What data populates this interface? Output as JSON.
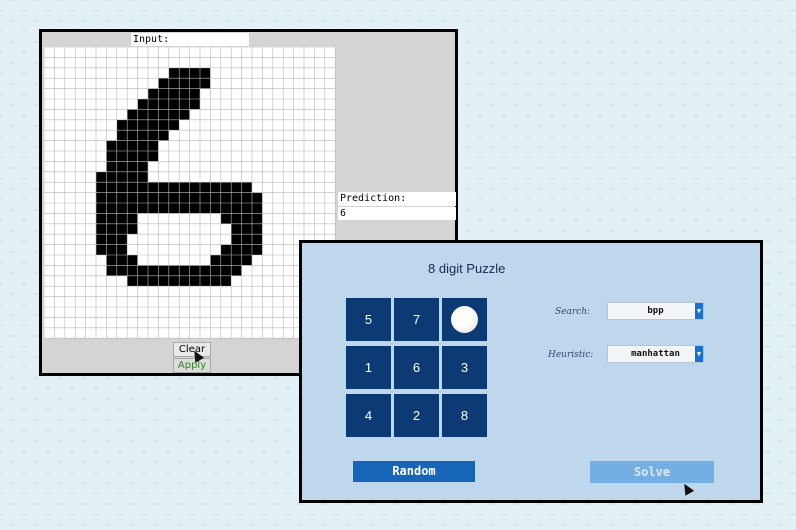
{
  "digit_app": {
    "input_label": "Input:",
    "prediction_label": "Prediction:",
    "prediction_value": "6",
    "clear_label": "Clear",
    "apply_label": "Apply",
    "grid": {
      "rows": 28,
      "cols": 28,
      "filled": [
        [
          2,
          12,
          15
        ],
        [
          3,
          11,
          15
        ],
        [
          4,
          10,
          14
        ],
        [
          5,
          9,
          14
        ],
        [
          6,
          8,
          13
        ],
        [
          7,
          7,
          12
        ],
        [
          8,
          7,
          11
        ],
        [
          9,
          6,
          10
        ],
        [
          10,
          6,
          10
        ],
        [
          11,
          6,
          9
        ],
        [
          12,
          5,
          9
        ],
        [
          13,
          5,
          19
        ],
        [
          14,
          5,
          20
        ],
        [
          15,
          5,
          20
        ],
        [
          16,
          5,
          8
        ],
        [
          16,
          17,
          20
        ],
        [
          17,
          5,
          8
        ],
        [
          17,
          18,
          20
        ],
        [
          18,
          5,
          7
        ],
        [
          18,
          18,
          20
        ],
        [
          19,
          5,
          7
        ],
        [
          19,
          17,
          20
        ],
        [
          20,
          6,
          8
        ],
        [
          20,
          16,
          19
        ],
        [
          21,
          6,
          18
        ],
        [
          22,
          8,
          17
        ]
      ]
    }
  },
  "puzzle_app": {
    "title": "8 digit Puzzle",
    "tiles": [
      "5",
      "7",
      "",
      "1",
      "6",
      "3",
      "4",
      "2",
      "8"
    ],
    "search_label": "Search:",
    "search_value": "bpp",
    "heuristic_label": "Heuristic:",
    "heuristic_value": "manhattan",
    "random_label": "Random",
    "solve_label": "Solve",
    "colors": {
      "tile": "#0b3a74",
      "panel": "#bed7ec",
      "random_button": "#1665b7",
      "solve_button": "#75aee2"
    }
  }
}
